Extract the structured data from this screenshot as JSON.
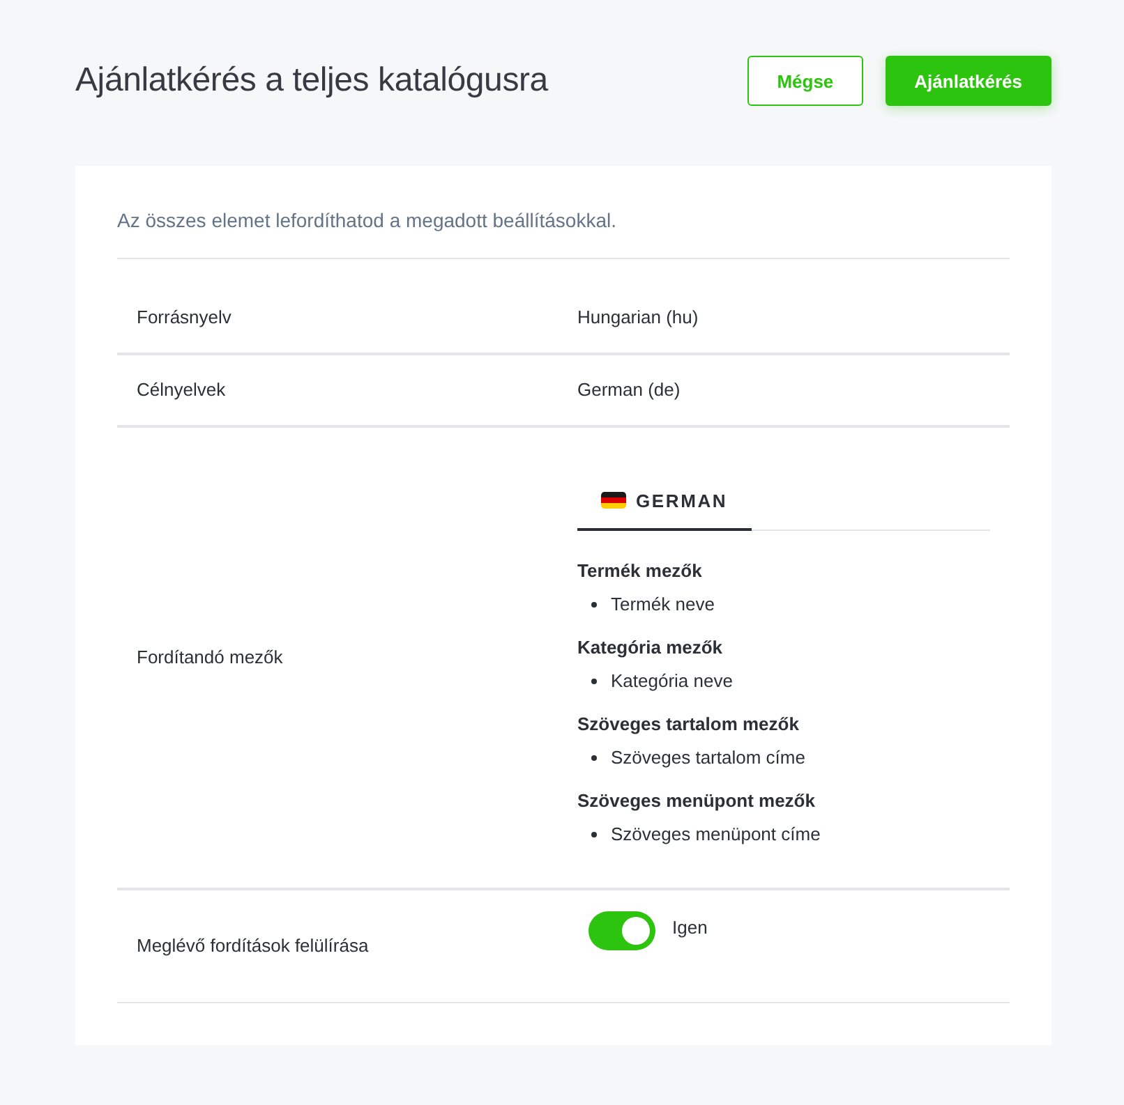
{
  "page": {
    "title": "Ajánlatkérés a teljes katalógusra"
  },
  "buttons": [
    {
      "label": "Mégse",
      "kind": "secondary"
    },
    {
      "label": "Ajánlatkérés",
      "kind": "primary"
    }
  ],
  "card": {
    "description": "Az összes elemet lefordíthatod a megadott beállításokkal.",
    "rows": [
      {
        "kind": "text",
        "label": "Forrásnyelv",
        "value": "Hungarian (hu)"
      },
      {
        "kind": "text",
        "label": "Célnyelvek",
        "value": "German (de)"
      },
      {
        "kind": "tabs",
        "label": "Fordítandó mezők",
        "tabs": [
          {
            "label": "GERMAN",
            "selected": true
          }
        ],
        "groups": [
          {
            "title": "Termék mezők",
            "items": [
              "Termék neve"
            ]
          },
          {
            "title": "Kategória mezők",
            "items": [
              "Kategória neve"
            ]
          },
          {
            "title": "Szöveges tartalom mezők",
            "items": [
              "Szöveges tartalom címe"
            ]
          },
          {
            "title": "Szöveges menüpont mezők",
            "items": [
              "Szöveges menüpont címe"
            ]
          }
        ]
      },
      {
        "kind": "toggle",
        "label": "Meglévő fordítások felülírása",
        "on": true,
        "value": "Igen"
      }
    ]
  }
}
